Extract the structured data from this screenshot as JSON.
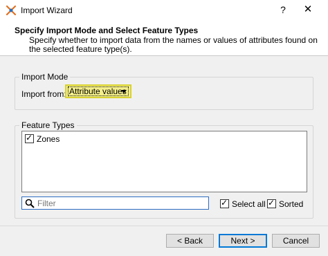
{
  "window": {
    "title": "Import Wizard",
    "help_label": "?",
    "close_label": "✕"
  },
  "header": {
    "title": "Specify Import Mode and Select Feature Types",
    "description": "Specify whether to import data from the names or values of attributes found on the selected feature type(s)."
  },
  "import_mode": {
    "group_label": "Import Mode",
    "import_from_label": "Import from:",
    "selected_value": "Attribute values",
    "highlight_color": "#f4ef8a"
  },
  "feature_types": {
    "group_label": "Feature Types",
    "items": [
      {
        "label": "Zones",
        "checked": true
      }
    ],
    "filter_placeholder": "Filter",
    "select_all_label": "Select all",
    "sorted_label": "Sorted"
  },
  "buttons": {
    "back": "< Back",
    "next": "Next >",
    "cancel": "Cancel"
  }
}
